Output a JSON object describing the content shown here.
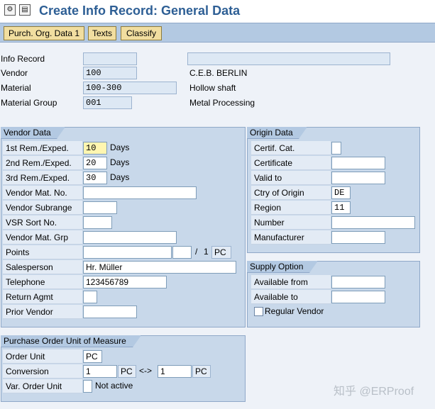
{
  "title": "Create Info Record: General Data",
  "toolbar": {
    "purch_org_label": "Purch. Org. Data 1",
    "texts_label": "Texts",
    "classify_label": "Classify"
  },
  "header": {
    "info_record_label": "Info Record",
    "info_record_value": "",
    "vendor_label": "Vendor",
    "vendor_value": "100",
    "vendor_name": "C.E.B. BERLIN",
    "material_label": "Material",
    "material_value": "100-300",
    "material_desc": "Hollow shaft",
    "material_group_label": "Material Group",
    "material_group_value": "001",
    "material_group_desc": "Metal Processing"
  },
  "vendor_data": {
    "title": "Vendor Data",
    "rem1_label": "1st Rem./Exped.",
    "rem1_value": "10",
    "rem1_unit": "Days",
    "rem2_label": "2nd Rem./Exped.",
    "rem2_value": "20",
    "rem2_unit": "Days",
    "rem3_label": "3rd Rem./Exped.",
    "rem3_value": "30",
    "rem3_unit": "Days",
    "vendor_mat_no_label": "Vendor Mat. No.",
    "vendor_subrange_label": "Vendor Subrange",
    "vsr_sort_label": "VSR Sort No.",
    "vendor_mat_grp_label": "Vendor Mat. Grp",
    "points_label": "Points",
    "points_sep": "/",
    "points_per": "1",
    "points_unit": "PC",
    "salesperson_label": "Salesperson",
    "salesperson_value": "Hr. Müller",
    "telephone_label": "Telephone",
    "telephone_value": "123456789",
    "return_agmt_label": "Return Agmt",
    "prior_vendor_label": "Prior Vendor"
  },
  "origin_data": {
    "title": "Origin Data",
    "certif_cat_label": "Certif. Cat.",
    "certificate_label": "Certificate",
    "valid_to_label": "Valid to",
    "ctry_label": "Ctry of Origin",
    "ctry_value": "DE",
    "region_label": "Region",
    "region_value": "11",
    "number_label": "Number",
    "manufacturer_label": "Manufacturer"
  },
  "supply_option": {
    "title": "Supply Option",
    "available_from_label": "Available from",
    "available_to_label": "Available to",
    "regular_vendor_label": "Regular Vendor"
  },
  "po_unit": {
    "title": "Purchase Order Unit of Measure",
    "order_unit_label": "Order Unit",
    "order_unit_value": "PC",
    "conversion_label": "Conversion",
    "conv_left_value": "1",
    "conv_left_unit": "PC",
    "conv_arrow": "<->",
    "conv_right_value": "1",
    "conv_right_unit": "PC",
    "var_order_unit_label": "Var. Order Unit",
    "var_order_unit_status": "Not active"
  },
  "watermark": "知乎 @ERProof"
}
